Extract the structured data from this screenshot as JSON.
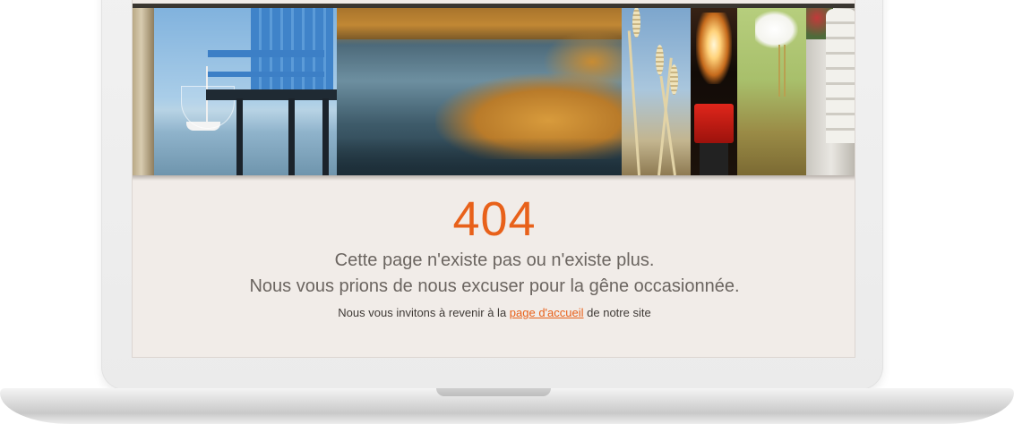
{
  "error": {
    "code": "404",
    "line1": "Cette page n'existe pas ou n'existe plus.",
    "line2": "Nous vous prions de nous excuser pour la gêne occasionnée.",
    "invite_before": "Nous vous invitons à revenir à la",
    "home_link_label": "page d'accueil",
    "invite_after": "de notre site"
  },
  "colors": {
    "accent": "#e8611a",
    "panel_background": "#f1ece8",
    "text_muted": "#6b6560"
  },
  "banner": {
    "photos": [
      "wood-post",
      "fishing-hut",
      "marsh-water",
      "reeds",
      "lighthouse-lamp",
      "heron",
      "stone-column"
    ]
  }
}
